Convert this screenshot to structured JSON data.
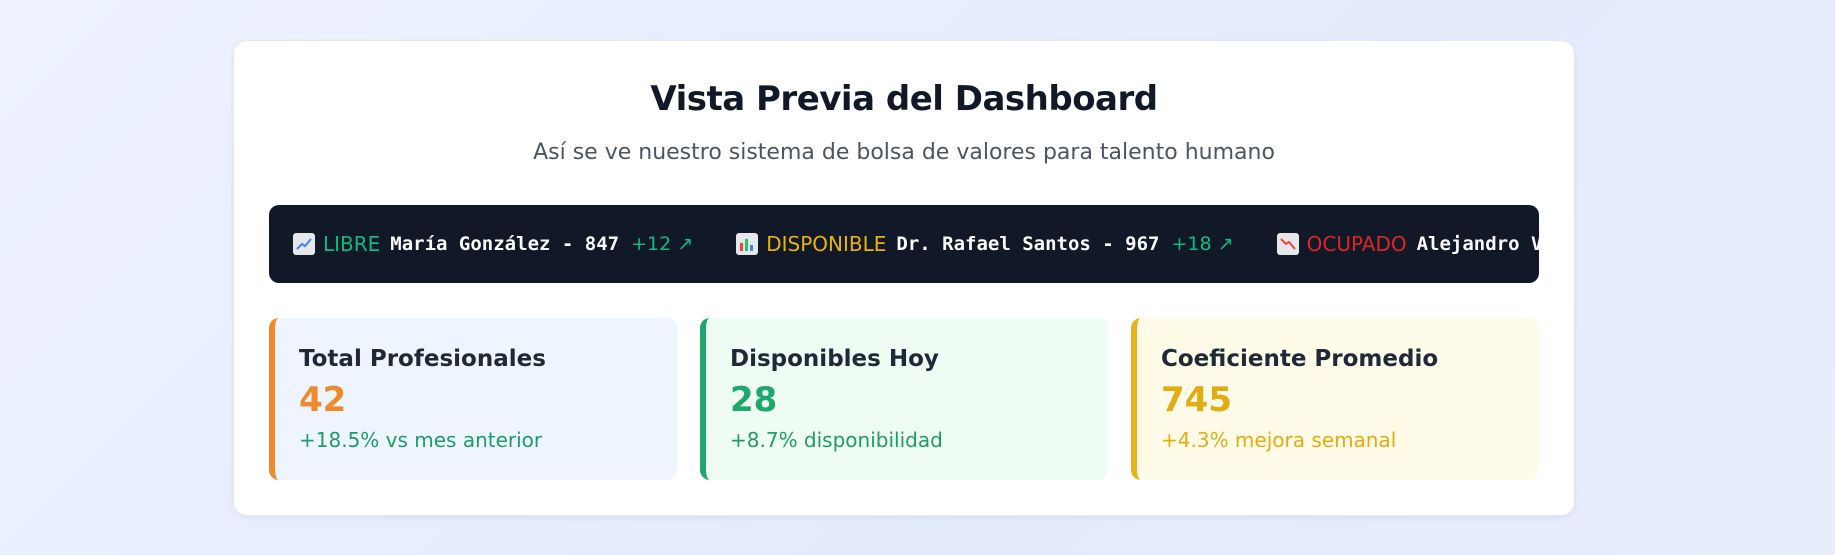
{
  "header": {
    "title": "Vista Previa del Dashboard",
    "subtitle": "Así se ve nuestro sistema de bolsa de valores para talento humano"
  },
  "ticker": {
    "items": [
      {
        "icon": "chart-up-icon",
        "status": "LIBRE",
        "status_color": "#10b981",
        "name": "María González - 847",
        "change": "+12 ↗"
      },
      {
        "icon": "bar-chart-icon",
        "status": "DISPONIBLE",
        "status_color": "#eab308",
        "name": "Dr. Rafael Santos - 967",
        "change": "+18 ↗"
      },
      {
        "icon": "chart-down-icon",
        "status": "OCUPADO",
        "status_color": "#dc2626",
        "name": "Alejandro Ve",
        "change": ""
      }
    ]
  },
  "stats": [
    {
      "label": "Total Profesionales",
      "value": "42",
      "note": "+18.5% vs mes anterior",
      "value_color": "#ee8a2c",
      "note_color": "#1f9d68"
    },
    {
      "label": "Disponibles Hoy",
      "value": "28",
      "note": "+8.7% disponibilidad",
      "value_color": "#1ea86b",
      "note_color": "#1f9d68"
    },
    {
      "label": "Coeficiente Promedio",
      "value": "745",
      "note": "+4.3% mejora semanal",
      "value_color": "#e2ac12",
      "note_color": "#e2ac12"
    }
  ]
}
